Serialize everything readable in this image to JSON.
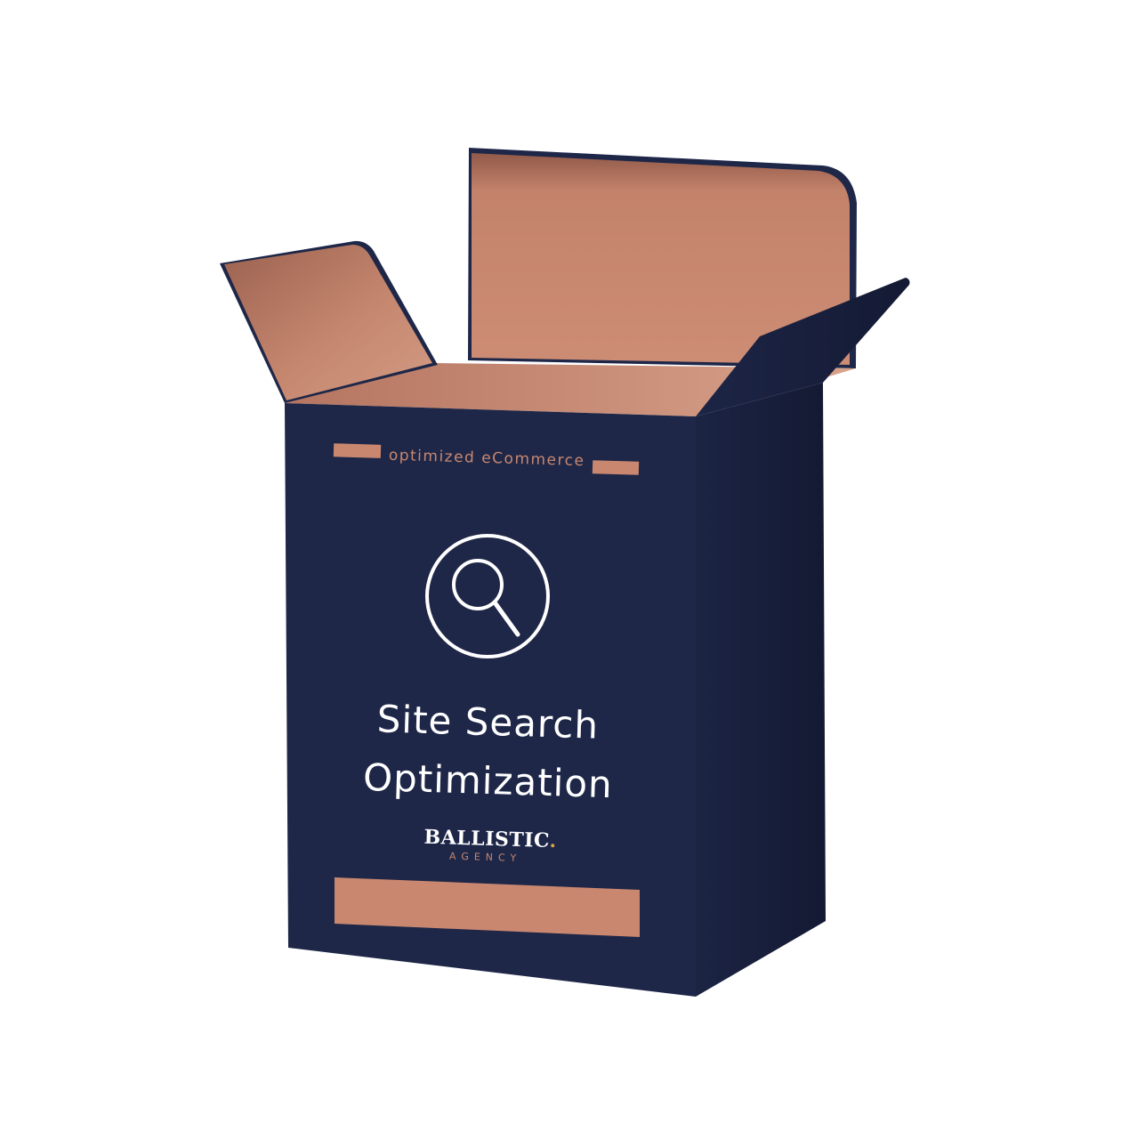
{
  "box": {
    "tagline": "optimized eCommerce",
    "title_line1": "Site Search",
    "title_line2": "Optimization",
    "icon": "magnifier-icon",
    "logo": {
      "brand": "BALLISTIC",
      "dot": ".",
      "sub": "AGENCY"
    }
  },
  "colors": {
    "background": "#ffffff",
    "navy": "#1e2748",
    "navy_dark": "#161d38",
    "navy_side": "#1a2241",
    "copper": "#c9876f",
    "copper_dark": "#9c6250",
    "copper_light": "#d49a82",
    "icon_stroke": "#ffffff",
    "logo_dot": "#d9a441"
  }
}
